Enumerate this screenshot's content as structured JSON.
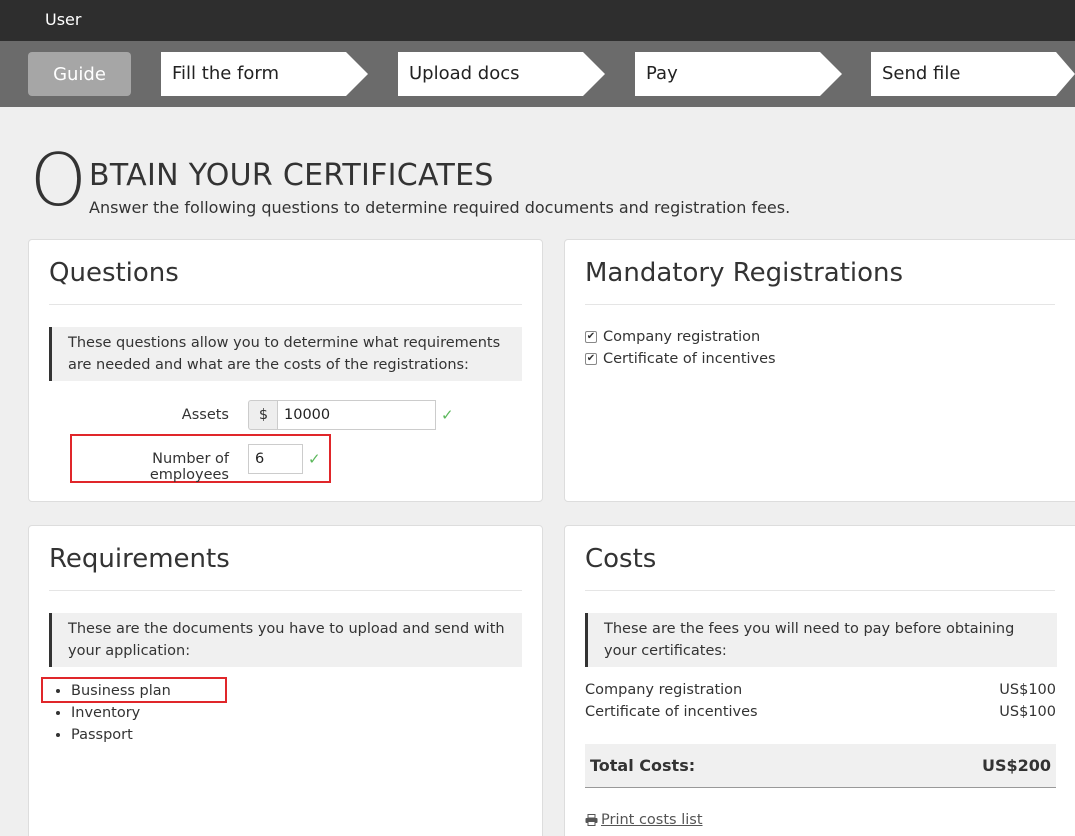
{
  "topbar": {
    "user_label": "User"
  },
  "steps": {
    "guide": "Guide",
    "items": [
      "Fill the form",
      "Upload docs",
      "Pay",
      "Send file"
    ]
  },
  "page": {
    "big_letter": "O",
    "title": "BTAIN YOUR CERTIFICATES",
    "subtitle": "Answer the following questions to determine required documents and registration fees."
  },
  "questions": {
    "heading": "Questions",
    "callout": "These questions allow you to determine what requirements are needed and what are the costs of the registrations:",
    "assets_label": "Assets",
    "currency_symbol": "$",
    "assets_value": "10000",
    "employees_label": "Number of employees",
    "employees_value": "6",
    "valid_mark": "✓"
  },
  "mandatory": {
    "heading": "Mandatory Registrations",
    "items": [
      "Company registration",
      "Certificate of incentives"
    ]
  },
  "requirements": {
    "heading": "Requirements",
    "callout": "These are the documents you have to upload and send with your application:",
    "items": [
      "Business plan",
      "Inventory",
      "Passport"
    ]
  },
  "costs": {
    "heading": "Costs",
    "callout": "These are the fees you will need to pay before obtaining your certificates:",
    "rows": [
      {
        "label": "Company registration",
        "amount": "US$100"
      },
      {
        "label": "Certificate of incentives",
        "amount": "US$100"
      }
    ],
    "total_label": "Total Costs:",
    "total_amount": "US$200",
    "print_label": "Print costs list"
  },
  "colors": {
    "highlight": "#e0262a",
    "valid": "#5cb85c",
    "topbar": "#2e2e2e",
    "stepsbar": "#6b6b6b"
  }
}
